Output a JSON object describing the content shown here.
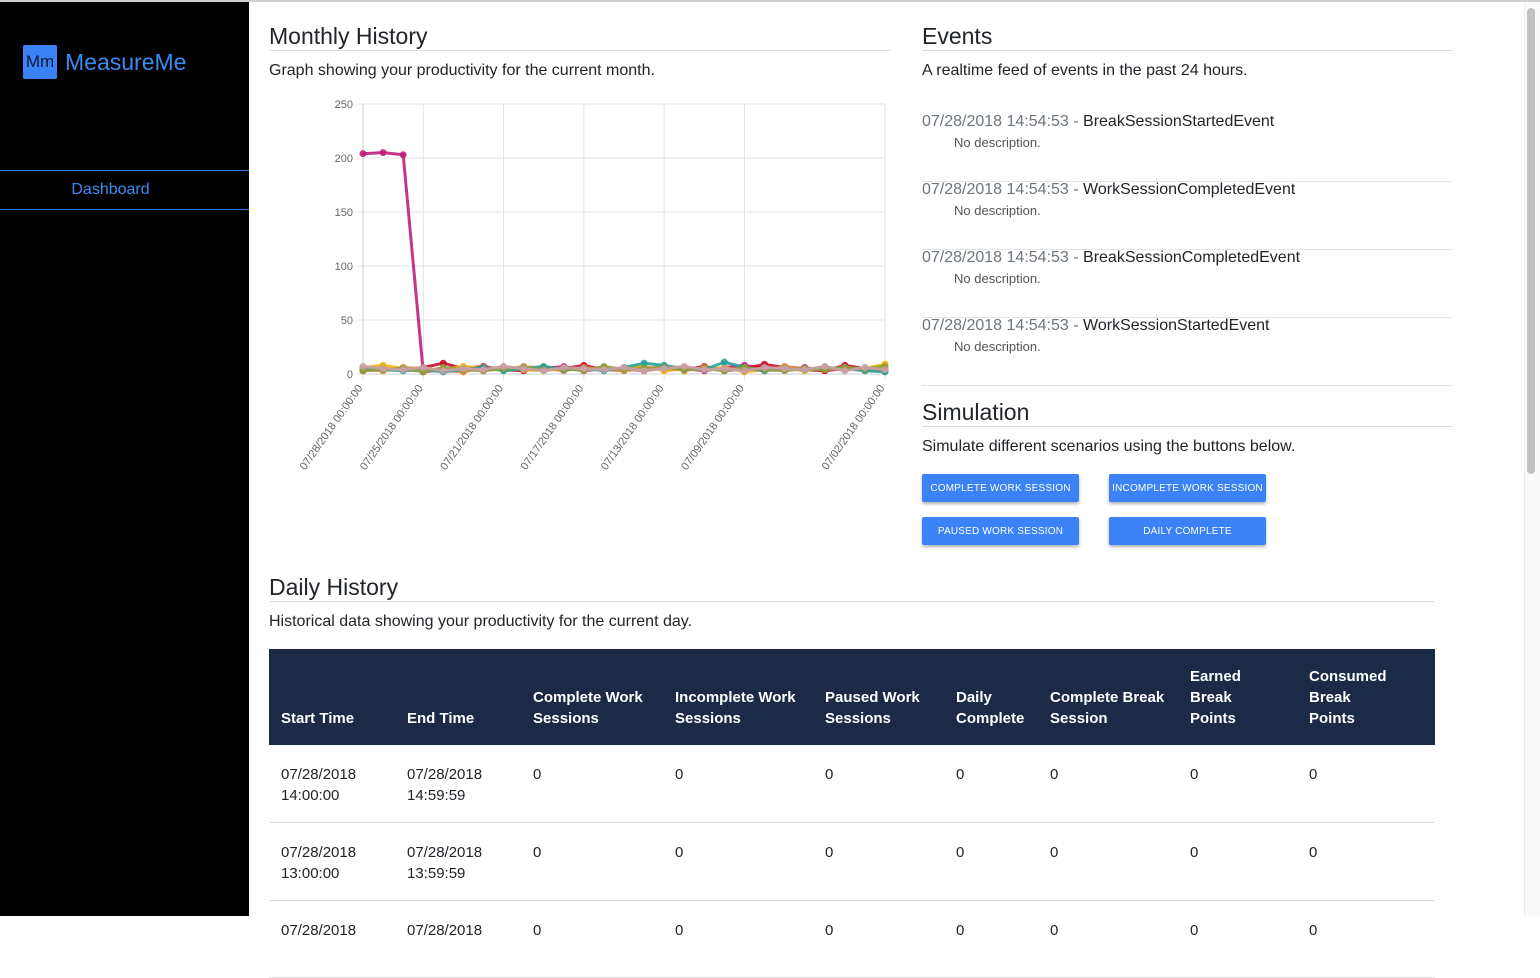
{
  "sidebar": {
    "logo_text": "Mm",
    "brand": "MeasureMe",
    "nav_items": [
      {
        "label": "Dashboard"
      }
    ]
  },
  "monthly": {
    "title": "Monthly History",
    "subtitle": "Graph showing your productivity for the current month."
  },
  "events": {
    "title": "Events",
    "subtitle": "A realtime feed of events in the past 24 hours.",
    "items": [
      {
        "timestamp": "07/28/2018 14:54:53",
        "sep": " - ",
        "name": "BreakSessionStartedEvent",
        "description": "No description."
      },
      {
        "timestamp": "07/28/2018 14:54:53",
        "sep": " - ",
        "name": "WorkSessionCompletedEvent",
        "description": "No description."
      },
      {
        "timestamp": "07/28/2018 14:54:53",
        "sep": " - ",
        "name": "BreakSessionCompletedEvent",
        "description": "No description."
      },
      {
        "timestamp": "07/28/2018 14:54:53",
        "sep": " - ",
        "name": "WorkSessionStartedEvent",
        "description": "No description."
      }
    ]
  },
  "simulation": {
    "title": "Simulation",
    "subtitle": "Simulate different scenarios using the buttons below.",
    "buttons": [
      {
        "label": "Complete Work Session"
      },
      {
        "label": "Incomplete Work Session"
      },
      {
        "label": "Paused Work Session"
      },
      {
        "label": "Daily Complete"
      }
    ]
  },
  "daily": {
    "title": "Daily History",
    "subtitle": "Historical data showing your productivity for the current day.",
    "columns": [
      {
        "line1": "Start Time",
        "line2": ""
      },
      {
        "line1": "End Time",
        "line2": ""
      },
      {
        "line1": "Complete Work",
        "line2": "Sessions"
      },
      {
        "line1": "Incomplete Work",
        "line2": "Sessions"
      },
      {
        "line1": "Paused Work",
        "line2": "Sessions"
      },
      {
        "line1": "Daily",
        "line2": "Complete"
      },
      {
        "line1": "Complete Break",
        "line2": "Session"
      },
      {
        "line1": "Earned Break",
        "line2": "Points"
      },
      {
        "line1": "Consumed Break",
        "line2": "Points"
      }
    ],
    "rows": [
      {
        "start_date": "07/28/2018",
        "start_time": "14:00:00",
        "end_date": "07/28/2018",
        "end_time": "14:59:59",
        "values": [
          "0",
          "0",
          "0",
          "0",
          "0",
          "0",
          "0"
        ]
      },
      {
        "start_date": "07/28/2018",
        "start_time": "13:00:00",
        "end_date": "07/28/2018",
        "end_time": "13:59:59",
        "values": [
          "0",
          "0",
          "0",
          "0",
          "0",
          "0",
          "0"
        ]
      },
      {
        "start_date": "07/28/2018",
        "start_time": "",
        "end_date": "07/28/2018",
        "end_time": "",
        "values": [
          "0",
          "0",
          "0",
          "0",
          "0",
          "0",
          "0"
        ]
      }
    ]
  },
  "chart_data": {
    "type": "line",
    "title": "",
    "xlabel": "",
    "ylabel": "",
    "ylim": [
      0,
      250
    ],
    "yticks": [
      0,
      50,
      100,
      150,
      200,
      250
    ],
    "grid": true,
    "legend": "none",
    "x_count": 27,
    "xtick_labels": [
      {
        "index": 0,
        "label": "07/28/2018 00:00:00"
      },
      {
        "index": 3,
        "label": "07/25/2018 00:00:00"
      },
      {
        "index": 7,
        "label": "07/21/2018 00:00:00"
      },
      {
        "index": 11,
        "label": "07/17/2018 00:00:00"
      },
      {
        "index": 15,
        "label": "07/13/2018 00:00:00"
      },
      {
        "index": 19,
        "label": "07/09/2018 00:00:00"
      },
      {
        "index": 26,
        "label": "07/02/2018 00:00:00"
      }
    ],
    "series": [
      {
        "color": "#c0207a",
        "values": [
          204,
          205,
          203,
          2,
          4,
          5,
          3,
          6,
          4,
          5,
          7,
          3,
          5,
          4,
          6,
          4,
          5,
          3,
          6,
          8,
          5,
          4,
          6,
          3,
          5,
          4,
          3
        ]
      },
      {
        "color": "#c8102e",
        "values": [
          3,
          5,
          4,
          6,
          10,
          5,
          7,
          4,
          3,
          6,
          5,
          8,
          4,
          5,
          3,
          6,
          4,
          7,
          3,
          5,
          9,
          6,
          4,
          3,
          8,
          5,
          4
        ]
      },
      {
        "color": "#f0b400",
        "values": [
          6,
          8,
          5,
          3,
          4,
          7,
          5,
          6,
          4,
          3,
          5,
          4,
          6,
          5,
          7,
          3,
          5,
          4,
          6,
          2,
          4,
          5,
          3,
          6,
          4,
          5,
          9
        ]
      },
      {
        "color": "#e8873a",
        "values": [
          4,
          3,
          6,
          5,
          3,
          2,
          6,
          4,
          7,
          5,
          3,
          6,
          4,
          3,
          5,
          7,
          3,
          6,
          4,
          5,
          3,
          7,
          5,
          4,
          6,
          3,
          5
        ]
      },
      {
        "color": "#2aa198",
        "values": [
          5,
          4,
          3,
          4,
          2,
          4,
          6,
          3,
          5,
          7,
          4,
          5,
          3,
          6,
          10,
          8,
          5,
          4,
          11,
          6,
          3,
          5,
          4,
          6,
          5,
          3,
          2
        ]
      },
      {
        "color": "#8f9d3a",
        "values": [
          3,
          4,
          5,
          2,
          6,
          4,
          3,
          5,
          6,
          4,
          5,
          3,
          7,
          4,
          5,
          6,
          4,
          5,
          3,
          6,
          4,
          3,
          5,
          4,
          6,
          5,
          7
        ]
      },
      {
        "color": "#c9a0a6",
        "values": [
          7,
          5,
          4,
          6,
          3,
          5,
          4,
          7,
          5,
          3,
          6,
          5,
          4,
          6,
          3,
          5,
          7,
          4,
          5,
          3,
          6,
          5,
          4,
          7,
          3,
          6,
          4
        ]
      }
    ]
  }
}
